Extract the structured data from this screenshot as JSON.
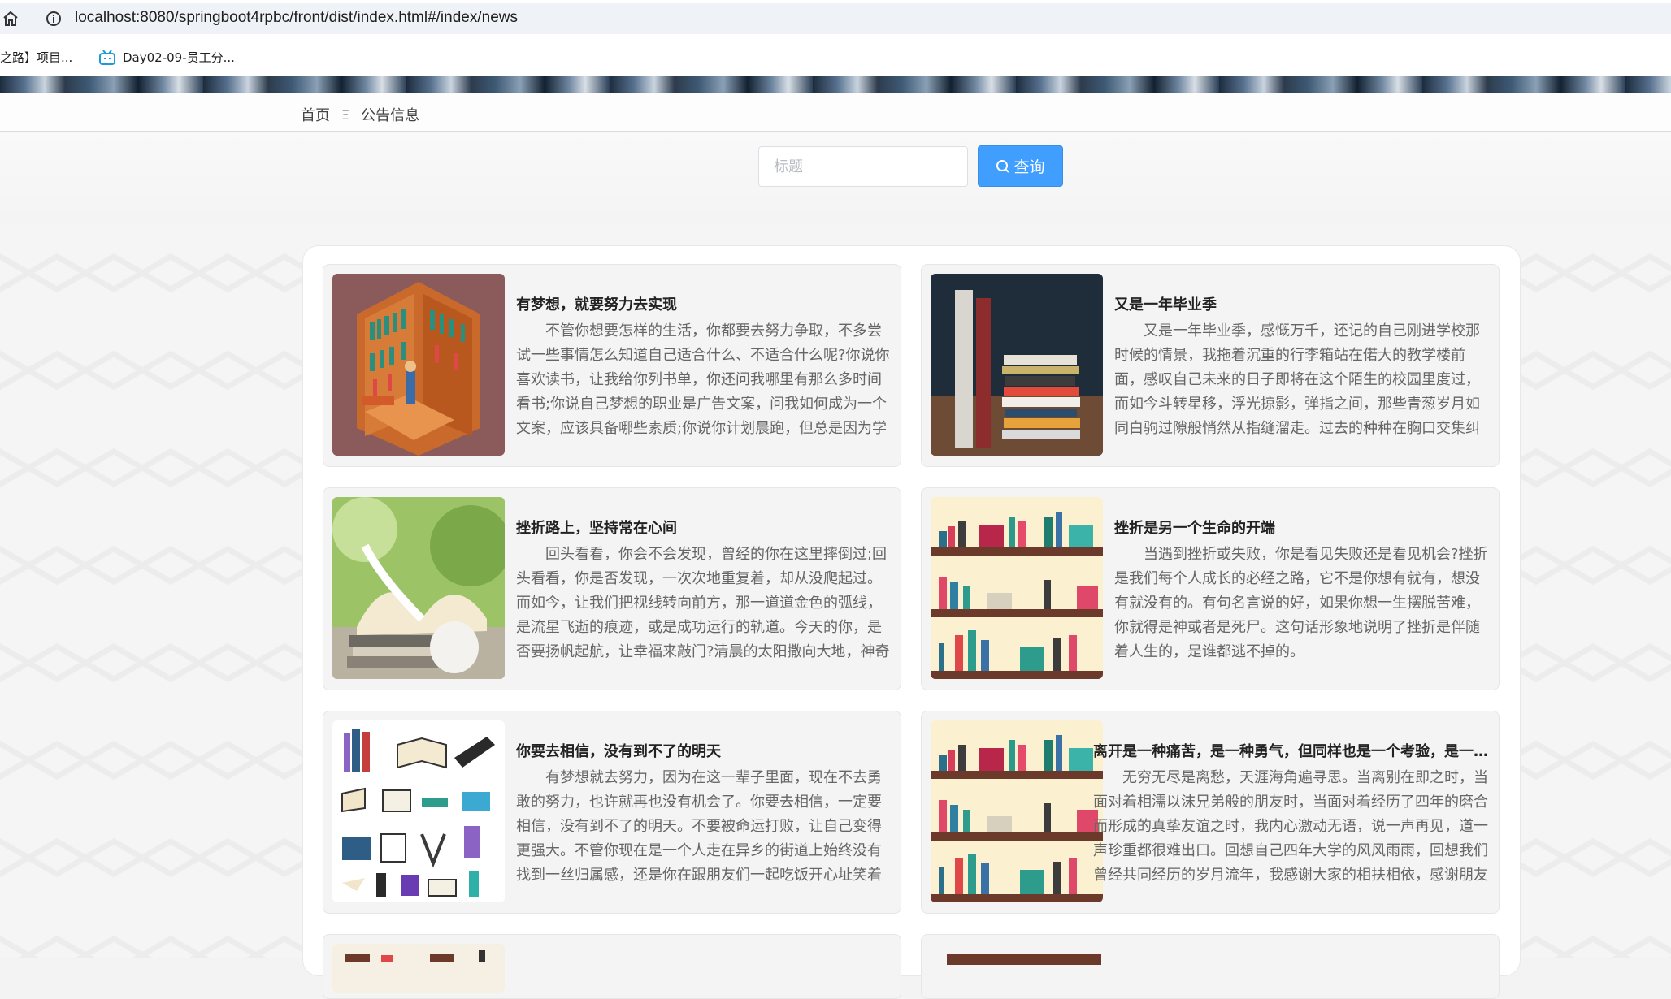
{
  "browser": {
    "url": "localhost:8080/springboot4rpbc/front/dist/index.html#/index/news",
    "bookmarks": [
      {
        "label": "之路】项目..."
      },
      {
        "label": "Day02-09-员工分..."
      }
    ]
  },
  "breadcrumb": {
    "home": "首页",
    "separator": "Ξ",
    "current": "公告信息"
  },
  "search": {
    "placeholder": "标题",
    "button_label": "查询"
  },
  "news": [
    {
      "title": "有梦想，就要努力去实现",
      "body": "不管你想要怎样的生活，你都要去努力争取，不多尝试一些事情怎么知道自己适合什么、不适合什么呢?你说你喜欢读书，让我给你列书单，你还问我哪里有那么多时间看书;你说自己梦想的职业是广告文案，问我如何成为一个文案，应该具备哪些素质;你说你计划晨跑，但总是因为学",
      "image": "library-room-illustration"
    },
    {
      "title": "又是一年毕业季",
      "body": "又是一年毕业季，感慨万千，还记的自己刚进学校那时候的情景，我拖着沉重的行李箱站在偌大的教学楼前面，感叹自己未来的日子即将在这个陌生的校园里度过，而如今斗转星移，浮光掠影，弹指之间，那些青葱岁月如同白驹过隙般悄然从指缝溜走。过去的种种在胸口交集纠",
      "image": "stacked-books-photo"
    },
    {
      "title": "挫折路上，坚持常在心间",
      "body": "回头看看，你会不会发现，曾经的你在这里摔倒过;回头看看，你是否发现，一次次地重复着，却从没爬起过。而如今，让我们把视线转向前方，那一道道金色的弧线，是流星飞逝的痕迹，或是成功运行的轨道。今天的你，是否要扬帆起航，让幸福来敲门?清晨的太阳撒向大地，神奇",
      "image": "open-book-photo"
    },
    {
      "title": "挫折是另一个生命的开端",
      "body": "当遇到挫折或失败，你是看见失败还是看见机会?挫折是我们每个人成长的必经之路，它不是你想有就有，想没有就没有的。有句名言说的好，如果你想一生摆脱苦难，你就得是神或者是死尸。这句话形象地说明了挫折是伴随着人生的，是谁都逃不掉的。",
      "image": "bookshelf-illustration"
    },
    {
      "title": "你要去相信，没有到不了的明天",
      "body": "有梦想就去努力，因为在这一辈子里面，现在不去勇敢的努力，也许就再也没有机会了。你要去相信，一定要相信，没有到不了的明天。不要被命运打败，让自己变得更强大。不管你现在是一个人走在异乡的街道上始终没有找到一丝归属感，还是你在跟朋友们一起吃饭开心址笑着",
      "image": "books-icon-set"
    },
    {
      "title": "离开是一种痛苦，是一种勇气，但同样也是一个考验，是一种成长",
      "body": "无穷无尽是离愁，天涯海角遍寻思。当离别在即之时，当面对着相濡以沫兄弟般的朋友时，当面对着经历了四年的磨合而形成的真挚友谊之时，我内心激动无语，说一声再见，道一声珍重都很难出口。回想自己四年大学的风风雨雨，回想我们曾经共同经历的岁月流年，我感谢大家的相扶相依，感谢朋友",
      "image": "bookshelf-illustration"
    }
  ],
  "colors": {
    "primary": "#409eff",
    "card_bg": "#f4f4f4",
    "title": "#222222",
    "body_text": "#666666"
  }
}
